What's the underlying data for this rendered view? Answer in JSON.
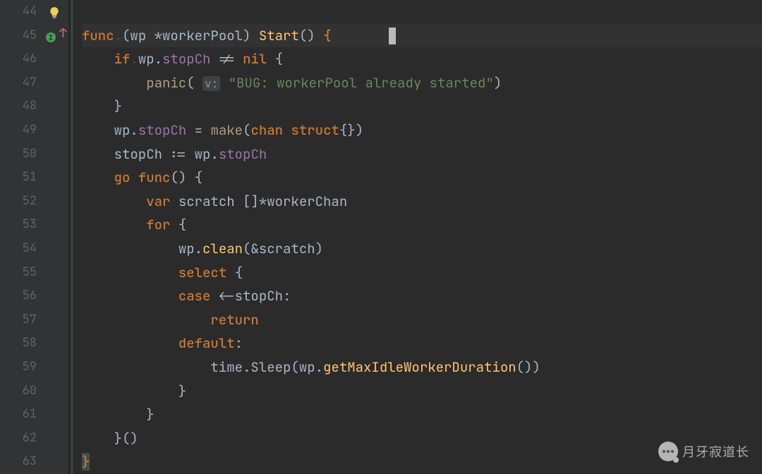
{
  "watermark": "月牙寂道长",
  "gutter": {
    "start": 44,
    "end": 63
  },
  "code": {
    "l44": "",
    "l45": {
      "func": "func",
      "recv_open": "(",
      "wp": "wp ",
      "type": "*workerPool",
      "recv_close": ") ",
      "name": "Start",
      "parens": "() ",
      "brace": "{"
    },
    "l46": {
      "if": "if",
      "wp": "wp",
      "dot": ".",
      "field": "stopCh",
      "neq": " != ",
      "nil": "nil",
      "brace": " {"
    },
    "l47": {
      "panic": "panic",
      "p_open": "( ",
      "hint": "v:",
      "sp": " ",
      "str": "\"BUG: workerPool already started\"",
      "p_close": ")"
    },
    "l48": {
      "brace": "}"
    },
    "l49": {
      "wp": "wp",
      "dot": ".",
      "field": "stopCh",
      "eq": " = ",
      "make": "make",
      "p_open": "(",
      "chan": "chan",
      "sp": " ",
      "struct": "struct",
      "empty": "{}",
      "p_close": ")"
    },
    "l50": {
      "lhs": "stopCh",
      "decl": " := ",
      "wp": "wp",
      "dot": ".",
      "field": "stopCh"
    },
    "l51": {
      "go": "go",
      "sp": " ",
      "func": "func",
      "parens": "() ",
      "brace": "{"
    },
    "l52": {
      "var": "var",
      "sp": " ",
      "name": "scratch ",
      "slice": "[]*workerChan"
    },
    "l53": {
      "for": "for",
      "brace": " {"
    },
    "l54": {
      "wp": "wp",
      "dot": ".",
      "mth": "clean",
      "args": "(&scratch)"
    },
    "l55": {
      "sel": "select",
      "brace": " {"
    },
    "l56": {
      "case": "case",
      "recv": " <-stopCh:"
    },
    "l57": {
      "ret": "return"
    },
    "l58": {
      "def": "default",
      "colon": ":"
    },
    "l59": {
      "time": "time.Sleep(",
      "wp": "wp",
      "dot": ".",
      "mth": "getMaxIdleWorkerDuration",
      "tail": "())"
    },
    "l60": {
      "brace": "}"
    },
    "l61": {
      "brace": "}"
    },
    "l62": {
      "close": "}()"
    },
    "l63": {
      "brace": "}"
    }
  }
}
